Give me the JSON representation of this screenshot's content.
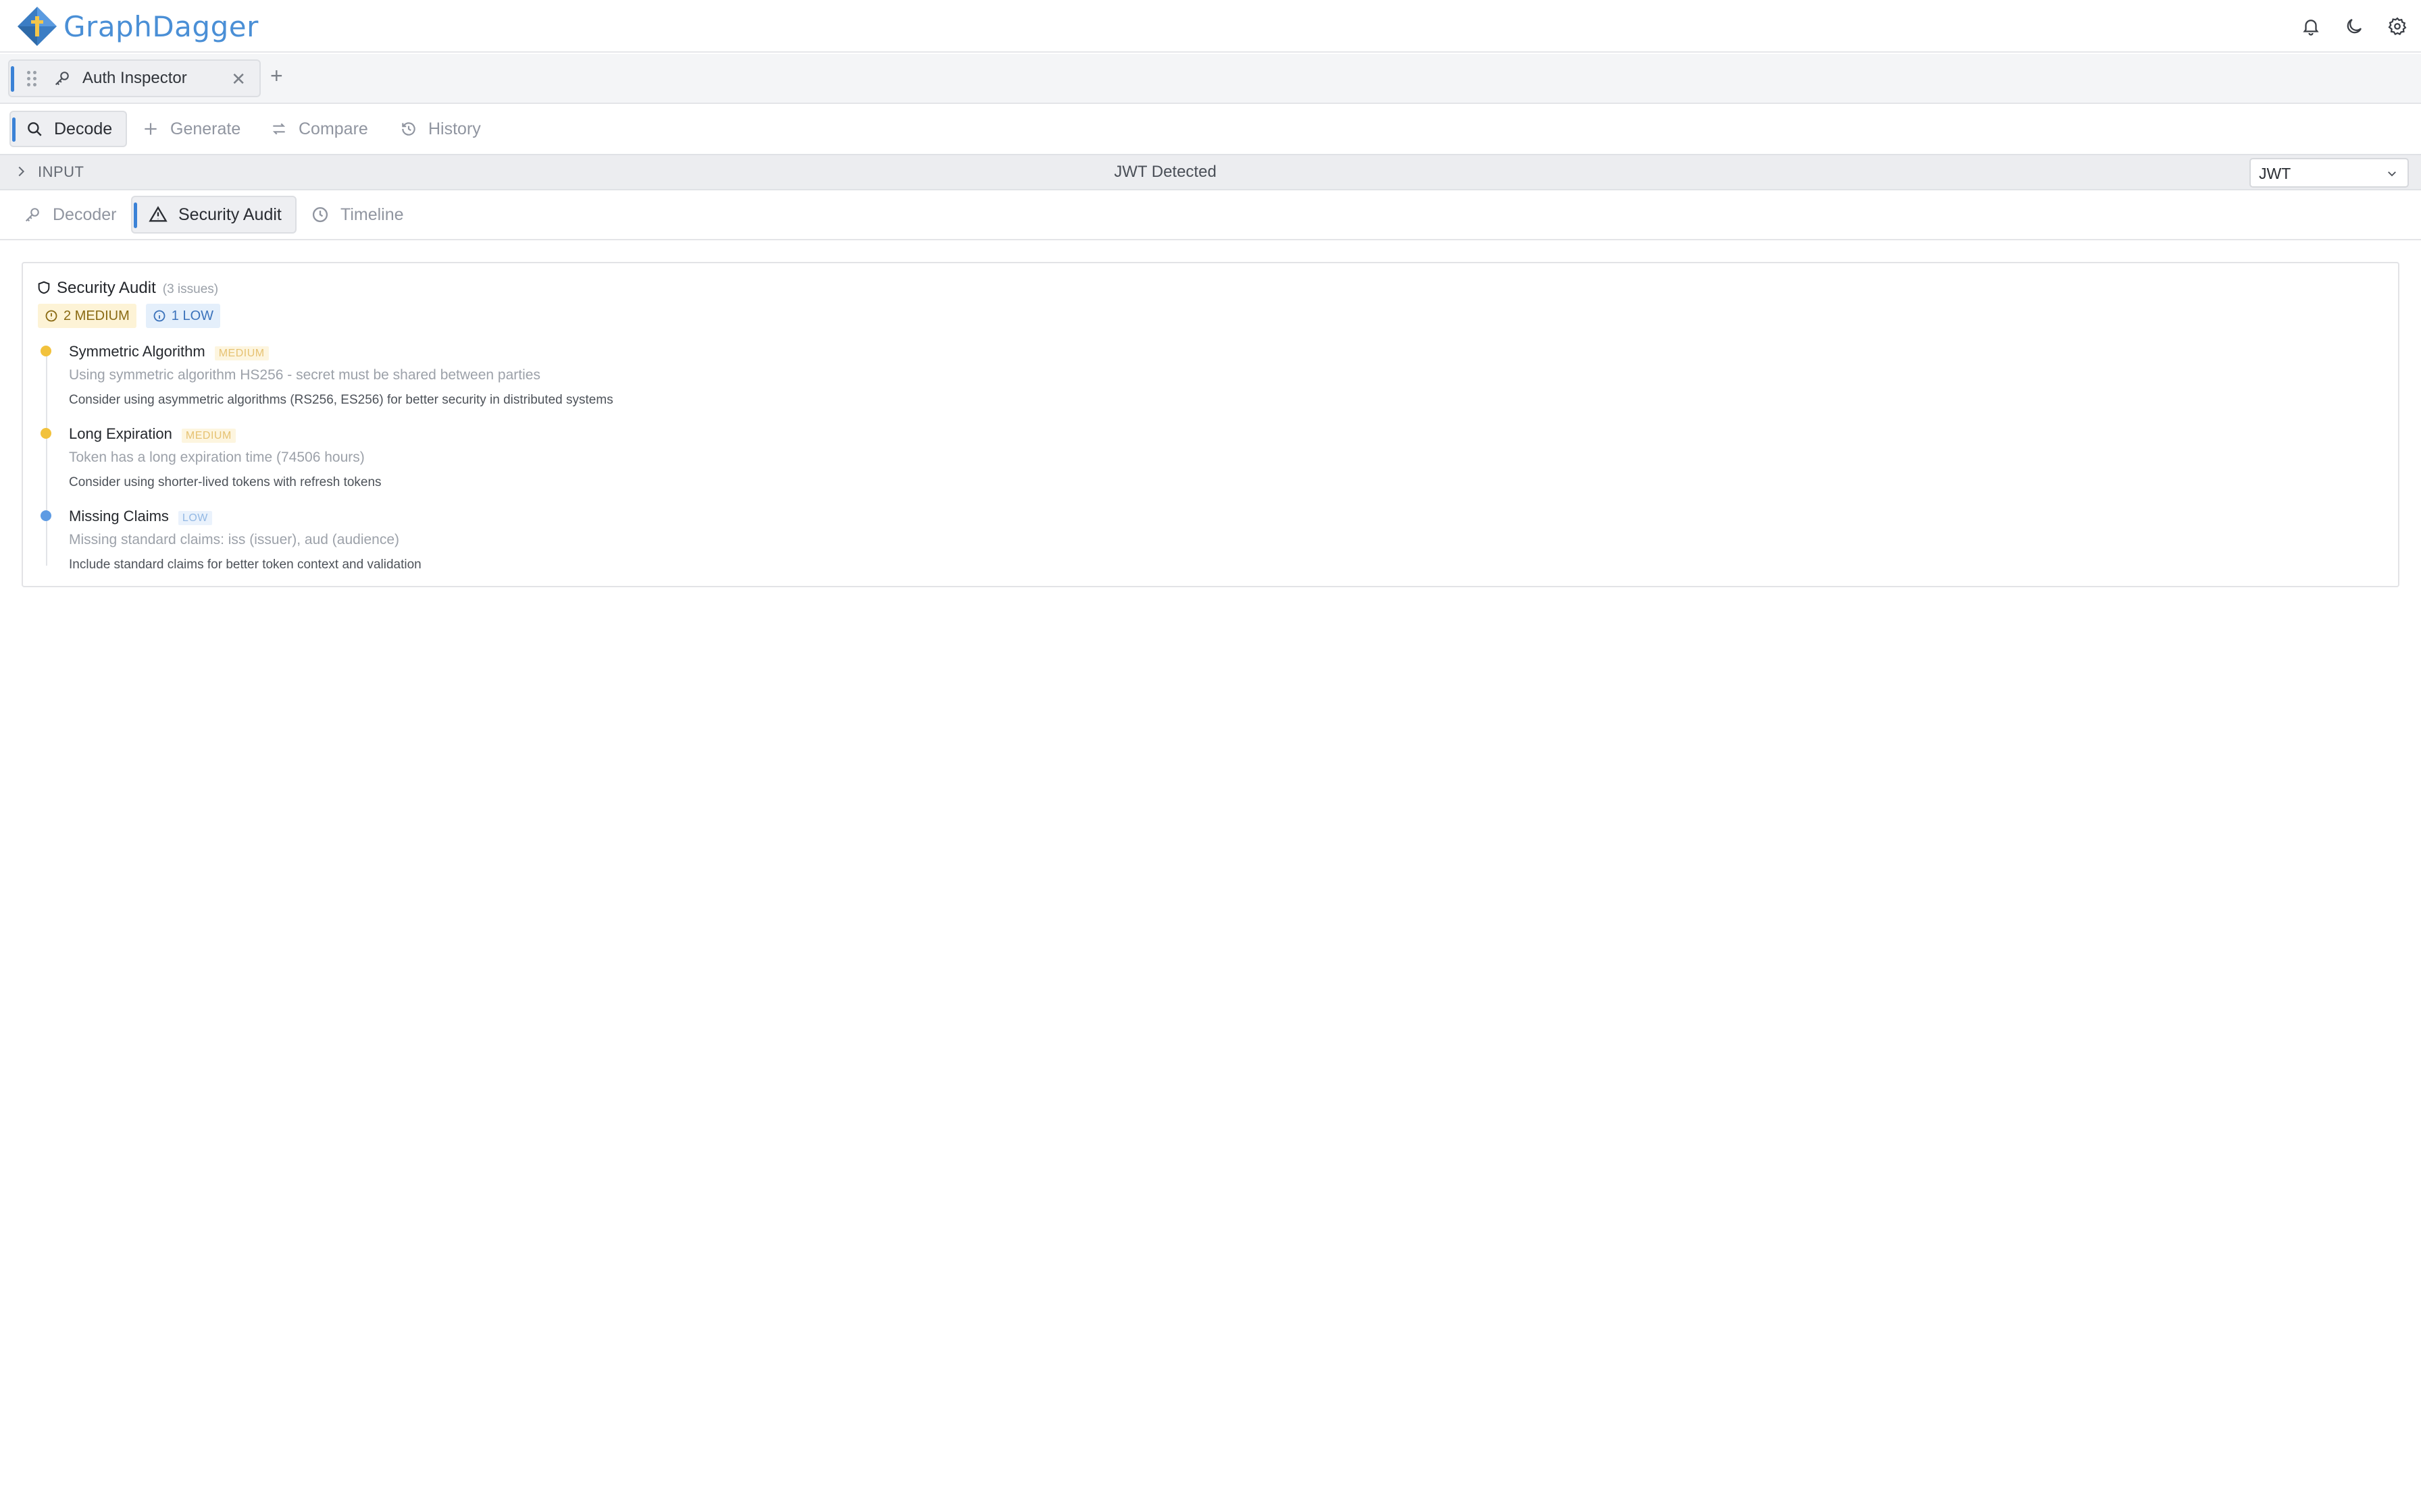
{
  "app": {
    "name": "GraphDagger"
  },
  "header_icons": [
    "bell-icon",
    "moon-icon",
    "gear-icon"
  ],
  "tabs": [
    {
      "label": "Auth Inspector",
      "icon": "key-icon"
    }
  ],
  "toolbar": {
    "items": [
      {
        "label": "Decode",
        "icon": "search-icon",
        "active": true
      },
      {
        "label": "Generate",
        "icon": "plus-icon"
      },
      {
        "label": "Compare",
        "icon": "swap-icon"
      },
      {
        "label": "History",
        "icon": "history-icon"
      }
    ]
  },
  "input_bar": {
    "label": "INPUT",
    "status": "JWT Detected",
    "format_select": "JWT"
  },
  "subtabs": [
    {
      "label": "Decoder",
      "icon": "key-icon"
    },
    {
      "label": "Security Audit",
      "icon": "warning-icon",
      "active": true
    },
    {
      "label": "Timeline",
      "icon": "clock-icon"
    }
  ],
  "audit": {
    "title": "Security Audit",
    "count": "(3 issues)",
    "badges": {
      "medium": "2 MEDIUM",
      "low": "1 LOW"
    },
    "issues": [
      {
        "name": "Symmetric Algorithm",
        "severity": "MEDIUM",
        "description": "Using symmetric algorithm HS256 - secret must be shared between parties",
        "recommendation": "Consider using asymmetric algorithms (RS256, ES256) for better security in distributed systems"
      },
      {
        "name": "Long Expiration",
        "severity": "MEDIUM",
        "description": "Token has a long expiration time (74506 hours)",
        "recommendation": "Consider using shorter-lived tokens with refresh tokens"
      },
      {
        "name": "Missing Claims",
        "severity": "LOW",
        "description": "Missing standard claims: iss (issuer), aud (audience)",
        "recommendation": "Include standard claims for better token context and validation"
      }
    ]
  },
  "colors": {
    "accent": "#3b82d6",
    "brand": "#4a8fd6",
    "medium": "#f2c23c",
    "low": "#5e9be3"
  }
}
